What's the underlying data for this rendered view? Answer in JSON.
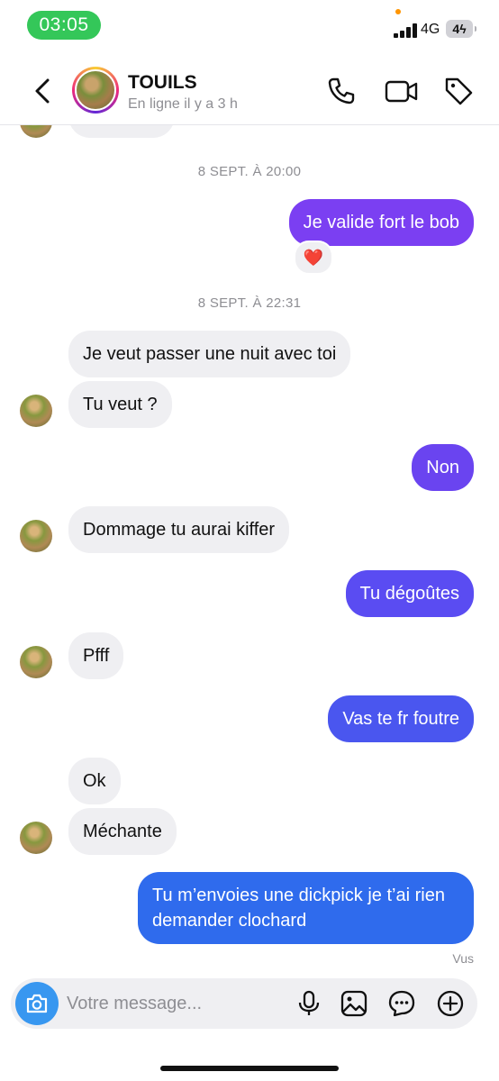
{
  "status_bar": {
    "time": "03:05",
    "network": "4G",
    "battery": "4"
  },
  "header": {
    "name": "TOUILS",
    "status": "En ligne il y a 3 h",
    "icons": [
      "back-icon",
      "phone-icon",
      "video-icon",
      "tag-icon"
    ]
  },
  "chat": {
    "timestamp_1": "8 SEPT. À 20:00",
    "timestamp_2": "8 SEPT. À 22:31",
    "messages": [
      {
        "from": "me",
        "text": "Je valide fort le bob",
        "reaction": "❤️"
      },
      {
        "from": "them",
        "text": "Je veut passer une nuit avec toi"
      },
      {
        "from": "them",
        "text": "Tu veut ?"
      },
      {
        "from": "me",
        "text": "Non"
      },
      {
        "from": "them",
        "text": "Dommage tu aurai kiffer"
      },
      {
        "from": "me",
        "text": "Tu dégoûtes"
      },
      {
        "from": "them",
        "text": "Pfff"
      },
      {
        "from": "me",
        "text": "Vas te fr foutre"
      },
      {
        "from": "them",
        "text": "Ok"
      },
      {
        "from": "them",
        "text": "Méchante"
      },
      {
        "from": "me",
        "text_line_1": "Tu m’envoies une dickpick je t’ai rien",
        "text_line_2": "demander clochard"
      }
    ],
    "seen_label": "Vus",
    "bubble_colors": [
      "#7b3ff2",
      "#6a44f0",
      "#5a4cf2",
      "#4a56ef",
      "#3b62ee",
      "#2f6bed"
    ]
  },
  "composer": {
    "placeholder": "Votre message...",
    "icons": [
      "camera-icon",
      "microphone-icon",
      "image-icon",
      "sticker-icon",
      "add-icon"
    ]
  }
}
